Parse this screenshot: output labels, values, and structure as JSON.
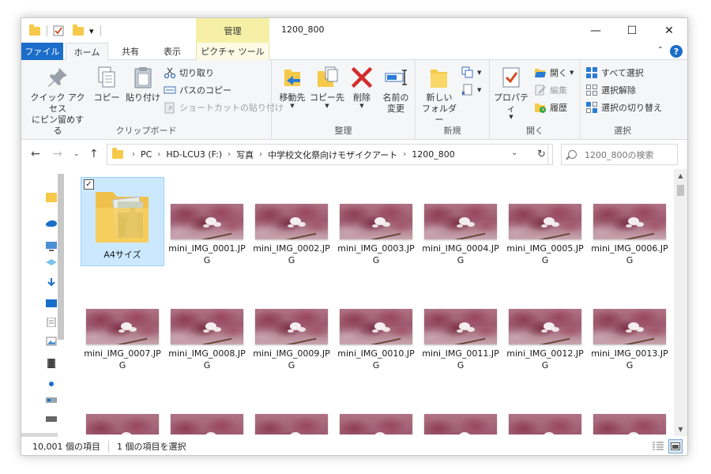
{
  "window": {
    "title": "1200_800",
    "context_tab_header": "管理",
    "controls": {
      "minimize": "—",
      "maximize": "☐",
      "close": "✕"
    }
  },
  "quick_access": {
    "dropdown": "▾"
  },
  "tabs": [
    {
      "label": "ファイル"
    },
    {
      "label": "ホーム"
    },
    {
      "label": "共有"
    },
    {
      "label": "表示"
    },
    {
      "label": "ピクチャ ツール"
    }
  ],
  "ribbon": {
    "clipboard": {
      "label": "クリップボード",
      "pin_line1": "クイック アクセス",
      "pin_line2": "にピン留めする",
      "copy": "コピー",
      "paste": "貼り付け",
      "cut": "切り取り",
      "copy_path": "パスのコピー",
      "paste_shortcut": "ショートカットの貼り付け"
    },
    "organize": {
      "label": "整理",
      "move_to": "移動先",
      "copy_to": "コピー先",
      "delete": "削除",
      "rename_line1": "名前の",
      "rename_line2": "変更"
    },
    "new": {
      "label": "新規",
      "new_folder_line1": "新しい",
      "new_folder_line2": "フォルダー"
    },
    "open": {
      "label": "開く",
      "properties": "プロパティ",
      "open": "開く",
      "edit": "編集",
      "history": "履歴"
    },
    "select": {
      "label": "選択",
      "select_all": "すべて選択",
      "select_none": "選択解除",
      "invert": "選択の切り替え"
    }
  },
  "address": {
    "crumbs": [
      "PC",
      "HD-LCU3 (F:)",
      "写真",
      "中学校文化祭向けモザイクアート",
      "1200_800"
    ],
    "search_placeholder": "1200_800の検索"
  },
  "items": [
    {
      "label": "A4サイズ",
      "type": "folder",
      "selected": true
    },
    {
      "label": "mini_IMG_0001.JPG"
    },
    {
      "label": "mini_IMG_0002.JPG"
    },
    {
      "label": "mini_IMG_0003.JPG"
    },
    {
      "label": "mini_IMG_0004.JPG"
    },
    {
      "label": "mini_IMG_0005.JPG"
    },
    {
      "label": "mini_IMG_0006.JPG"
    },
    {
      "label": "mini_IMG_0007.JPG"
    },
    {
      "label": "mini_IMG_0008.JPG"
    },
    {
      "label": "mini_IMG_0009.JPG"
    },
    {
      "label": "mini_IMG_0010.JPG"
    },
    {
      "label": "mini_IMG_0011.JPG"
    },
    {
      "label": "mini_IMG_0012.JPG"
    },
    {
      "label": "mini_IMG_0013.JPG"
    },
    {
      "label": ""
    },
    {
      "label": ""
    },
    {
      "label": ""
    },
    {
      "label": ""
    },
    {
      "label": ""
    },
    {
      "label": ""
    },
    {
      "label": ""
    }
  ],
  "status": {
    "item_count": "10,001 個の項目",
    "selected_count": "1 個の項目を選択"
  },
  "colors": {
    "accent": "#1a6ec9",
    "context_tab": "#f5f0a6",
    "selection": "#cce8ff",
    "folder": "#f5c94a"
  }
}
